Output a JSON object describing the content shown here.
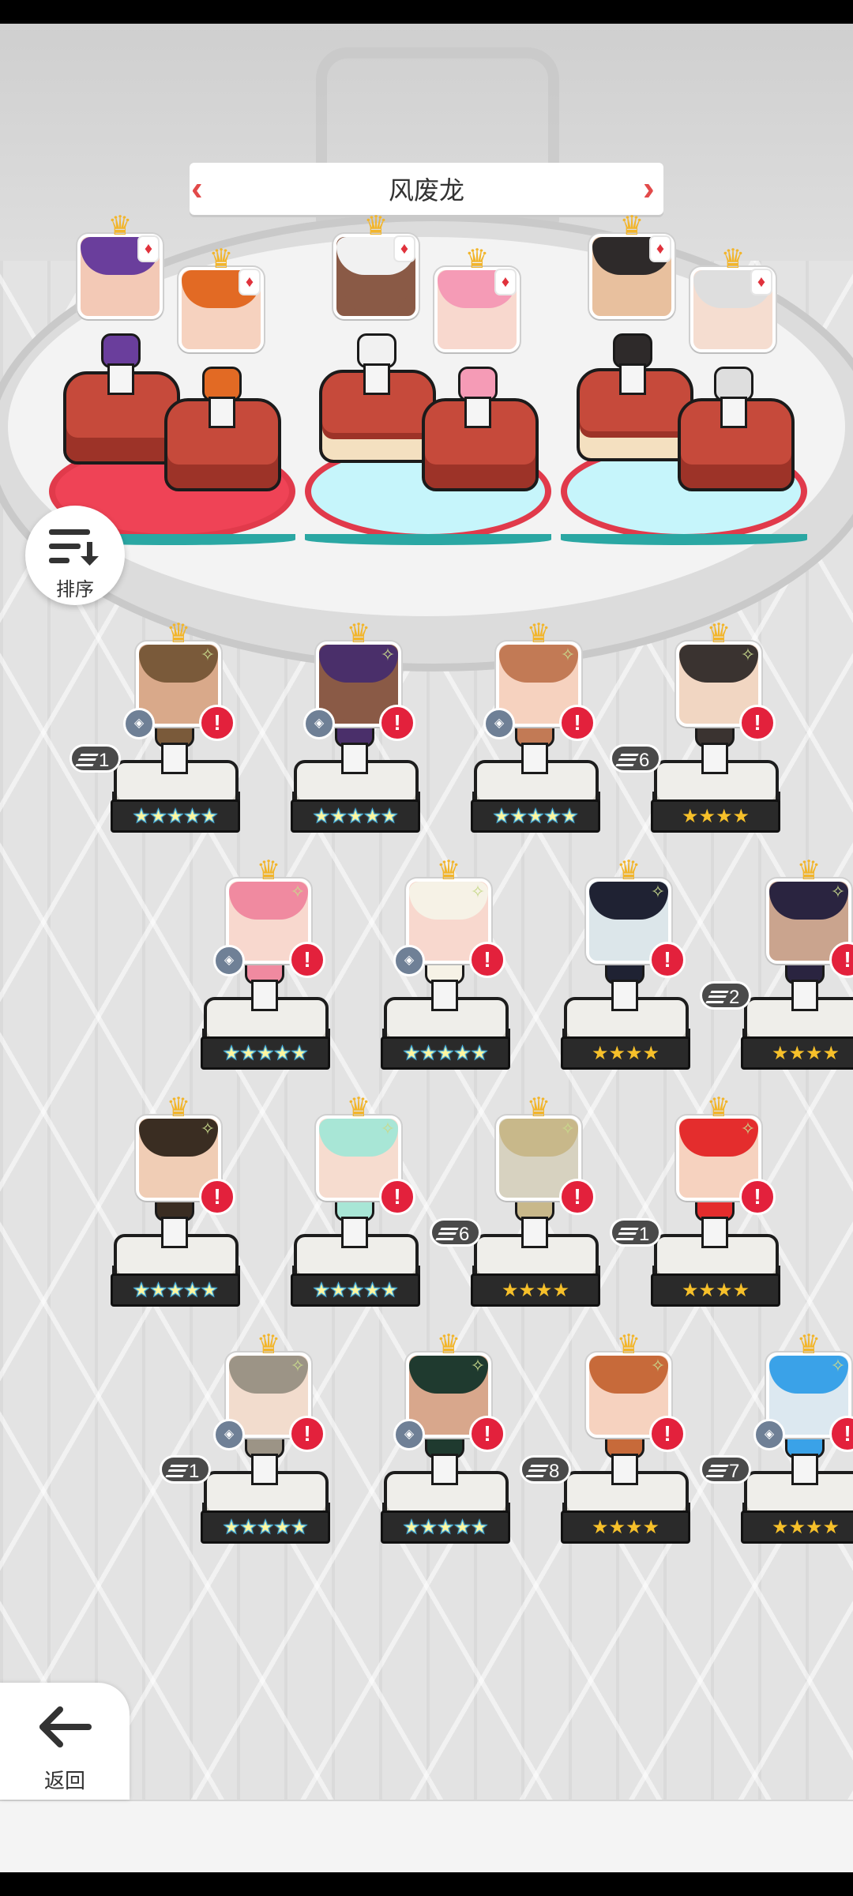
{
  "stage": {
    "title": "风废龙"
  },
  "buttons": {
    "sort_label": "排序",
    "back_label": "返回"
  },
  "icons": {
    "crown": "crown-icon",
    "card": "diamond-card-icon",
    "sparkle": "sparkle-icon",
    "alert": "exclamation-icon",
    "rank": "rank-badge-icon",
    "sort": "sort-icon",
    "back": "arrow-left-icon"
  },
  "glyphs": {
    "crown": "♛",
    "diamond": "♦",
    "spark": "✧",
    "alert": "!",
    "rank": "◈"
  },
  "colors": {
    "alert": "#e3213c",
    "crown": "#f2b52b",
    "team_ring": "#e13a4b",
    "team_disc_cyan": "#c6f5fb"
  },
  "heroes": [
    {
      "stars": "★★★★★",
      "level": "1"
    },
    {
      "stars": "★★★★★",
      "level": ""
    },
    {
      "stars": "★★★★★",
      "level": ""
    },
    {
      "stars": "★★★★",
      "level": "6"
    },
    {
      "stars": "★★★★★",
      "level": ""
    },
    {
      "stars": "★★★★★",
      "level": ""
    },
    {
      "stars": "★★★★",
      "level": ""
    },
    {
      "stars": "★★★★",
      "level": "2"
    },
    {
      "stars": "★★★★★",
      "level": ""
    },
    {
      "stars": "★★★★★",
      "level": ""
    },
    {
      "stars": "★★★★",
      "level": "6"
    },
    {
      "stars": "★★★★",
      "level": "1"
    },
    {
      "stars": "★★★★★",
      "level": "1"
    },
    {
      "stars": "★★★★★",
      "level": ""
    },
    {
      "stars": "★★★★",
      "level": "8"
    },
    {
      "stars": "★★★★",
      "level": "7"
    }
  ]
}
